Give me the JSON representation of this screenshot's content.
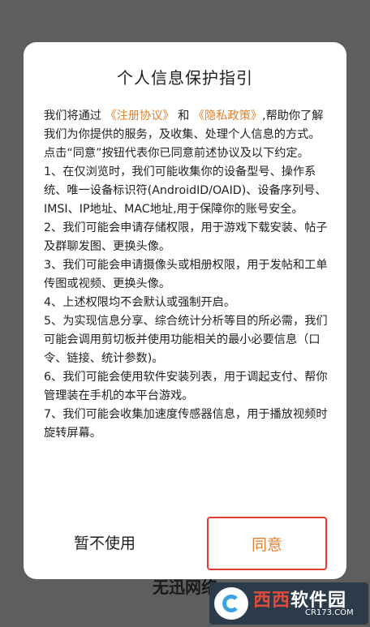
{
  "background": {
    "partial_text": "无迅网络"
  },
  "dialog": {
    "title": "个人信息保护指引",
    "intro_before": "我们将通过",
    "link_agreement": "《注册协议》",
    "intro_and": "和",
    "link_privacy": "《隐私政策》",
    "intro_after": ",帮助你了解我们为你提供的服务，及收集、处理个人信息的方式。",
    "consent_line": "点击“同意”按钮代表你已同意前述协议及以下约定。",
    "items": [
      "1、在仅浏览时，我们可能收集你的设备型号、操作系统、唯一设备标识符(AndroidID/OAID)、设备序列号、IMSI、IP地址、MAC地址,用于保障你的账号安全。",
      "2、我们可能会申请存储权限，用于游戏下载安装、帖子及群聊发图、更换头像。",
      "3、我们可能会申请摄像头或相册权限，用于发帖和工单传图或视频、更换头像。",
      "4、上述权限均不会默认或强制开启。",
      "5、为实现信息分享、综合统计分析等目的所必需，我们可能会调用剪切板并使用功能相关的最小必要信息（口令、链接、统计参数)。",
      "6、我们可能会使用软件安装列表，用于调起支付、帮你管理装在手机的本平台游戏。",
      "7、我们可能会收集加速度传感器信息，用于播放视频时旋转屏幕。"
    ],
    "buttons": {
      "cancel": "暂不使用",
      "agree": "同意"
    }
  },
  "watermark": {
    "name_a": "西西",
    "name_b": "软件园",
    "url": "CR173.COM"
  },
  "colors": {
    "link": "#e0822d",
    "highlight_border": "#e33b33",
    "overlay": "#5e5e5e"
  }
}
